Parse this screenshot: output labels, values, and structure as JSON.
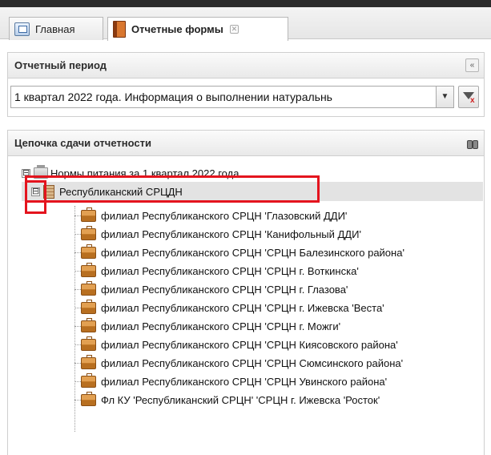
{
  "tabs": [
    {
      "label": "Главная",
      "icon": "home-icon",
      "active": false
    },
    {
      "label": "Отчетные формы",
      "icon": "book-icon",
      "active": true,
      "closable": true
    }
  ],
  "period_panel": {
    "title": "Отчетный период",
    "collapse_label": "«",
    "selected_value": "1 квартал 2022 года. Информация о выполнении натуральнь"
  },
  "chain_panel": {
    "title": "Цепочка сдачи отчетности",
    "root": {
      "label": "Нормы питания за 1 квартал 2022 года",
      "expander": "⊟"
    },
    "selected_node": {
      "label": "Республиканский СРЦДН",
      "expander": "⊟"
    },
    "branches": [
      "филиал Республиканского СРЦН 'Глазовский ДДИ'",
      "филиал Республиканского СРЦН 'Канифольный ДДИ'",
      "филиал Республиканского СРЦН 'СРЦН Балезинского района'",
      "филиал Республиканского СРЦН 'СРЦН г. Воткинска'",
      "филиал Республиканского СРЦН 'СРЦН г. Глазова'",
      "филиал Республиканского СРЦН 'СРЦН г. Ижевска 'Веста'",
      "филиал Республиканского СРЦН 'СРЦН г. Можги'",
      "филиал Республиканского СРЦН 'СРЦН Киясовского района'",
      "филиал Республиканского СРЦН 'СРЦН Сюмсинского района'",
      "филиал Республиканского СРЦН 'СРЦН Увинского района'",
      "Фл КУ 'Республиканский СРЦН' 'СРЦН г. Ижевска 'Росток'"
    ]
  },
  "colors": {
    "highlight": "#e4141e",
    "selected_row": "#e3e3e3",
    "top_bar": "#2b2b2b"
  }
}
